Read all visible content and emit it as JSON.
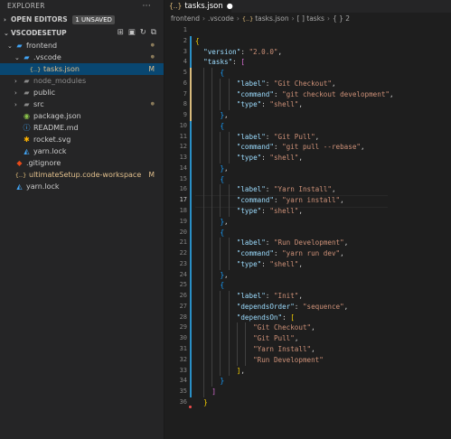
{
  "explorer": {
    "title": "EXPLORER",
    "more_icon": "ellipsis-icon",
    "open_editors": {
      "label": "OPEN EDITORS",
      "badge": "1 UNSAVED"
    },
    "workspace": {
      "label": "VSCODESETUP"
    },
    "tree": [
      {
        "name": "frontend",
        "kind": "folder-open",
        "indent": 1,
        "git": "dot"
      },
      {
        "name": ".vscode",
        "kind": "folder-open",
        "indent": 2,
        "git": "dot"
      },
      {
        "name": "tasks.json",
        "kind": "json",
        "indent": 3,
        "git": "M",
        "selected": true
      },
      {
        "name": "node_modules",
        "kind": "folder",
        "indent": 2,
        "git": ""
      },
      {
        "name": "public",
        "kind": "folder",
        "indent": 2,
        "git": ""
      },
      {
        "name": "src",
        "kind": "folder",
        "indent": 2,
        "git": "dot"
      },
      {
        "name": "package.json",
        "kind": "npm",
        "indent": 2,
        "git": ""
      },
      {
        "name": "README.md",
        "kind": "md",
        "indent": 2,
        "git": ""
      },
      {
        "name": "rocket.svg",
        "kind": "svg",
        "indent": 2,
        "git": ""
      },
      {
        "name": "yarn.lock",
        "kind": "yarn",
        "indent": 2,
        "git": ""
      },
      {
        "name": ".gitignore",
        "kind": "git",
        "indent": 1,
        "git": ""
      },
      {
        "name": "ultimateSetup.code-workspace",
        "kind": "json",
        "indent": 1,
        "git": "M"
      },
      {
        "name": "yarn.lock",
        "kind": "yarn",
        "indent": 1,
        "git": ""
      }
    ]
  },
  "editor": {
    "tab": {
      "label": "tasks.json",
      "dirty_marker": "●"
    },
    "breadcrumb": [
      "frontend",
      ".vscode",
      "tasks.json",
      "[ ] tasks",
      "{ } 2"
    ],
    "active_line": 17,
    "lines": [
      "",
      "{",
      "  \"version\": \"2.0.0\",",
      "  \"tasks\": [",
      "      {",
      "          \"label\": \"Git Checkout\",",
      "          \"command\": \"git checkout development\",",
      "          \"type\": \"shell\",",
      "      },",
      "      {",
      "          \"label\": \"Git Pull\",",
      "          \"command\": \"git pull --rebase\",",
      "          \"type\": \"shell\",",
      "      },",
      "      {",
      "          \"label\": \"Yarn Install\",",
      "          \"command\": \"yarn install\",",
      "          \"type\": \"shell\",",
      "      },",
      "      {",
      "          \"label\": \"Run Development\",",
      "          \"command\": \"yarn run dev\",",
      "          \"type\": \"shell\",",
      "      },",
      "      {",
      "          \"label\": \"Init\",",
      "          \"dependsOrder\": \"sequence\",",
      "          \"dependsOn\": [",
      "              \"Git Checkout\",",
      "              \"Git Pull\",",
      "              \"Yarn Install\",",
      "              \"Run Development\"",
      "          ],",
      "      }",
      "    ]",
      "  }"
    ]
  },
  "colors": {
    "key": "#9cdcfe",
    "string": "#ce9178",
    "bracket_level1": "#ffd700",
    "bracket_level2": "#da70d6",
    "bracket_level3": "#179fff",
    "modified": "#e2c08d",
    "selection": "#094771"
  }
}
